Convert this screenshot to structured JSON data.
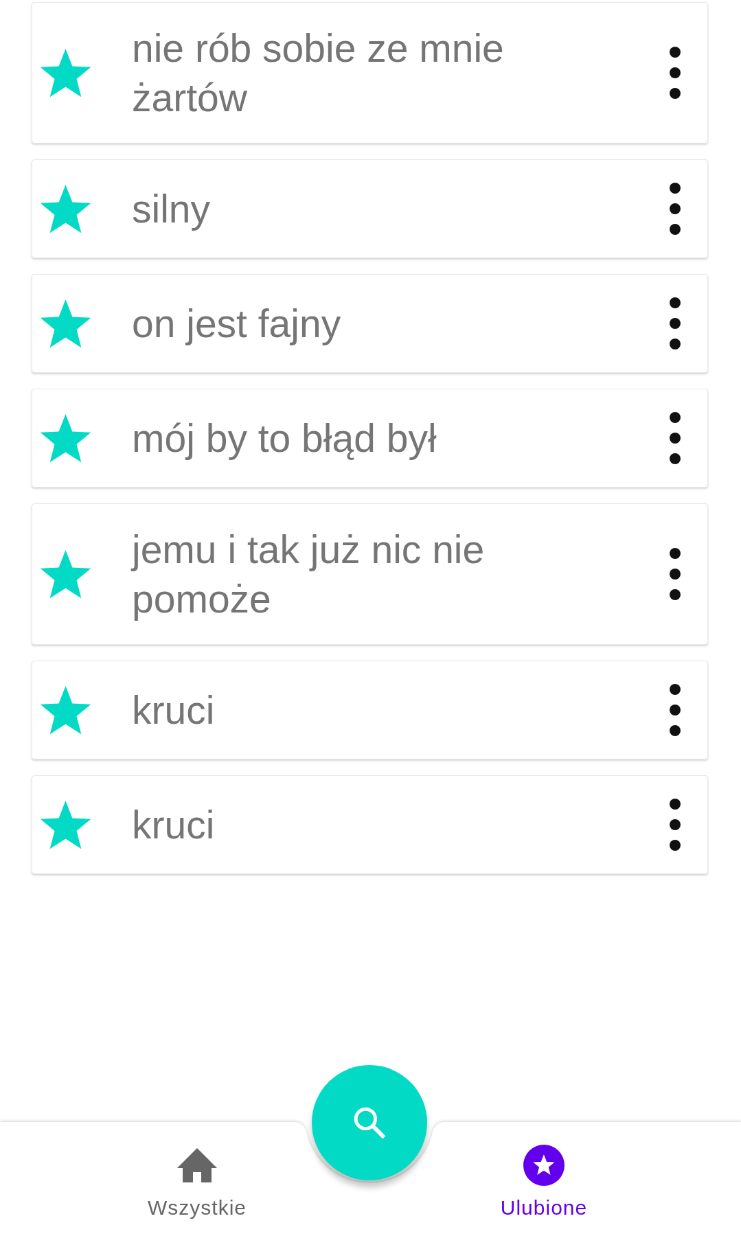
{
  "items": [
    {
      "text": "nie rób sobie ze mnie żartów",
      "starred": true
    },
    {
      "text": "silny",
      "starred": true
    },
    {
      "text": "on jest fajny",
      "starred": true
    },
    {
      "text": "mój by to błąd był",
      "starred": true
    },
    {
      "text": "jemu i tak już nic nie pomoże",
      "starred": true
    },
    {
      "text": "kruci",
      "starred": true
    },
    {
      "text": "kruci",
      "starred": true
    }
  ],
  "bottom_nav": {
    "items": [
      {
        "kind": "home",
        "label": "Wszystkie",
        "selected": false
      },
      {
        "kind": "star",
        "label": "Ulubione",
        "selected": true
      }
    ]
  }
}
